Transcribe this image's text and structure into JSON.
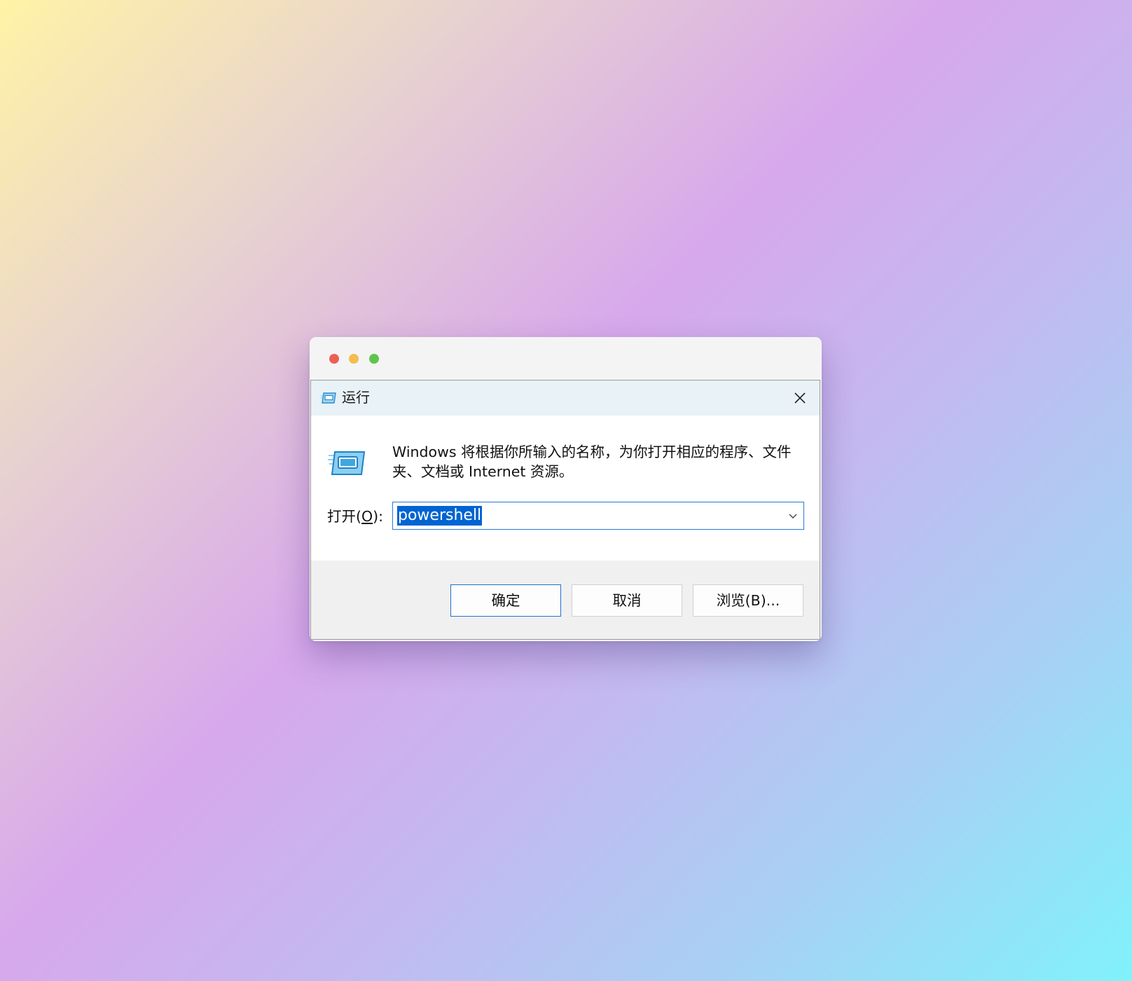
{
  "window_controls": {
    "close_color": "#ec5f57",
    "minimize_color": "#f4bd4f",
    "zoom_color": "#5ec54b"
  },
  "dialog": {
    "title": "运行",
    "title_icon": "run-icon",
    "close_icon": "close-icon",
    "description": "Windows 将根据你所输入的名称，为你打开相应的程序、文件夹、文档或 Internet 资源。",
    "open_label_prefix": "打开(",
    "open_label_key": "O",
    "open_label_suffix": "):",
    "input_value": "powershell",
    "input_selected": true,
    "dropdown_icon": "chevron-down-icon",
    "buttons": {
      "ok": "确定",
      "cancel": "取消",
      "browse": "浏览(B)..."
    },
    "accent_color": "#0064d2"
  }
}
